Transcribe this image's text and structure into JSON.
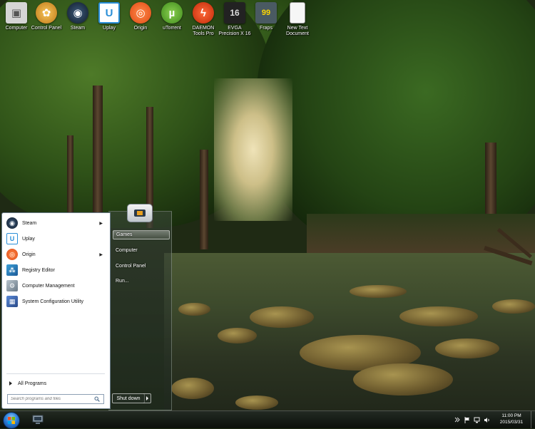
{
  "desktop": {
    "icons": [
      {
        "label": "Computer",
        "icon": "computer-icon",
        "color": "#c9c9c9"
      },
      {
        "label": "Control Panel",
        "icon": "control-panel-icon",
        "color": "#d8a020"
      },
      {
        "label": "Steam",
        "icon": "steam-icon",
        "color": "#1b2838"
      },
      {
        "label": "Uplay",
        "icon": "uplay-icon",
        "color": "#2a8fd8"
      },
      {
        "label": "Origin",
        "icon": "origin-icon",
        "color": "#f05a28"
      },
      {
        "label": "uTorrent",
        "icon": "utorrent-icon",
        "color": "#5aa82c"
      },
      {
        "label": "DAEMON Tools Pro",
        "icon": "daemon-tools-icon",
        "color": "#e0401c"
      },
      {
        "label": "EVGA Precision X 16",
        "icon": "evga-precision-icon",
        "color": "#2a2a2a"
      },
      {
        "label": "Fraps",
        "icon": "fraps-icon",
        "color": "#3a4a50"
      },
      {
        "label": "New Text Document",
        "icon": "text-document-icon",
        "color": "#f4f4f4"
      }
    ]
  },
  "start_menu": {
    "programs": [
      {
        "label": "Steam",
        "icon": "steam-icon",
        "has_submenu": true
      },
      {
        "label": "Uplay",
        "icon": "uplay-icon",
        "has_submenu": false
      },
      {
        "label": "Origin",
        "icon": "origin-icon",
        "has_submenu": true
      },
      {
        "label": "Registry Editor",
        "icon": "registry-editor-icon",
        "has_submenu": false
      },
      {
        "label": "Computer Management",
        "icon": "computer-management-icon",
        "has_submenu": false
      },
      {
        "label": "System Configuration Utility",
        "icon": "system-config-icon",
        "has_submenu": false
      }
    ],
    "all_programs_label": "All Programs",
    "search_placeholder": "Search programs and files",
    "right_items": [
      {
        "label": "Games",
        "highlighted": true
      },
      {
        "label": "Computer",
        "highlighted": false
      },
      {
        "label": "Control Panel",
        "highlighted": false
      },
      {
        "label": "Run...",
        "highlighted": false
      }
    ],
    "shutdown_label": "Shut down"
  },
  "taskbar": {
    "clock_time": "11:00 PM",
    "clock_date": "2015/03/31"
  },
  "colors": {
    "start_orb": "#2f7fd8",
    "start_menu_left_bg": "#ffffff",
    "taskbar_bg": "#1a201a"
  }
}
